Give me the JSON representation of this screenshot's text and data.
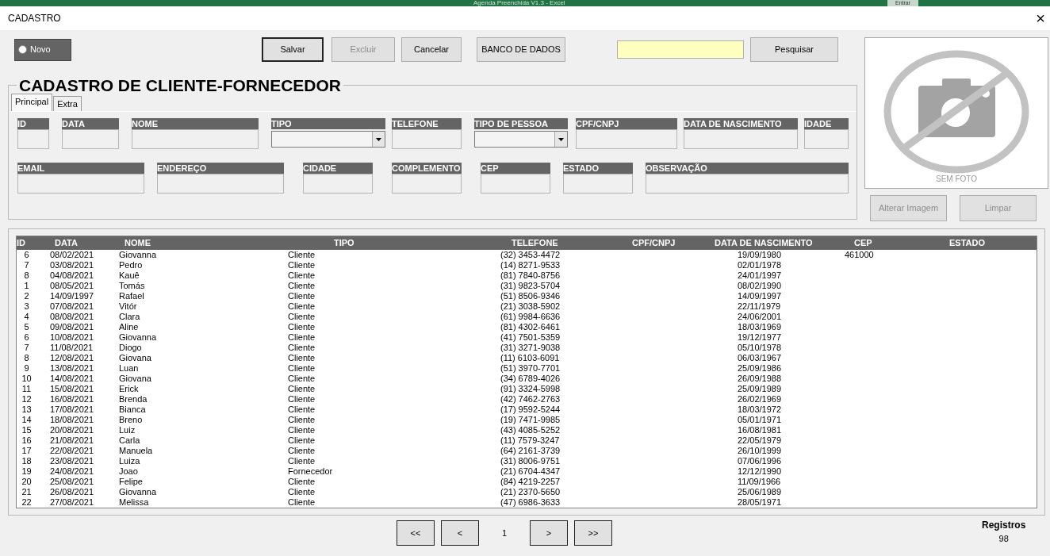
{
  "excel_bar": {
    "title": "Agenda Preenchida V1.3  -  Excel",
    "signin": "Entrar"
  },
  "window": {
    "title": "CADASTRO",
    "close": "×"
  },
  "toolbar": {
    "new_option": {
      "label": "Novo",
      "checked": false
    },
    "buttons": [
      {
        "label": "Salvar",
        "disabled": false,
        "default": true
      },
      {
        "label": "Excluir",
        "disabled": true,
        "default": false
      },
      {
        "label": "Cancelar",
        "disabled": false,
        "default": false
      },
      {
        "label": "BANCO DE DADOS",
        "disabled": false,
        "default": false
      }
    ],
    "search_button": "Pesquisar"
  },
  "form": {
    "title": "CADASTRO DE CLIENTE-FORNECEDOR",
    "tabs": [
      {
        "label": "Principal",
        "selected": true
      },
      {
        "label": "Extra",
        "selected": false
      }
    ],
    "field_rows": [
      {
        "fields": [
          {
            "label": "ID",
            "kind": "text"
          },
          {
            "label": "DATA",
            "kind": "text"
          },
          {
            "label": "NOME",
            "kind": "text"
          },
          {
            "label": "TIPO",
            "kind": "combo"
          },
          {
            "label": "TELEFONE",
            "kind": "text"
          },
          {
            "label": "TIPO DE PESSOA",
            "kind": "combo"
          },
          {
            "label": "CPF/CNPJ",
            "kind": "text"
          },
          {
            "label": "DATA DE NASCIMENTO",
            "kind": "text"
          },
          {
            "label": "IDADE",
            "kind": "text"
          }
        ]
      },
      {
        "fields": [
          {
            "label": "EMAIL",
            "kind": "text"
          },
          {
            "label": "ENDEREÇO",
            "kind": "text"
          },
          {
            "label": "CIDADE",
            "kind": "text"
          },
          {
            "label": "COMPLEMENTO",
            "kind": "text"
          },
          {
            "label": "CEP",
            "kind": "text"
          },
          {
            "label": "ESTADO",
            "kind": "text"
          },
          {
            "label": "OBSERVAÇÃO",
            "kind": "text"
          }
        ]
      }
    ]
  },
  "photo": {
    "caption": "SEM FOTO",
    "buttons": [
      {
        "label": "Alterar Imagem",
        "disabled": true
      },
      {
        "label": "Limpar",
        "disabled": true
      }
    ]
  },
  "table": {
    "columns": [
      "ID",
      "DATA",
      "NOME",
      "TIPO",
      "TELEFONE",
      "CPF/CNPJ",
      "DATA DE NASCIMENTO",
      "CEP",
      "ESTADO"
    ],
    "rows": [
      {
        "id": "6",
        "data": "08/02/2021",
        "nome": "Giovanna",
        "tipo": "Cliente",
        "telefone": "(32) 3453-4472",
        "nascimento": "19/09/1980",
        "cep": "461000"
      },
      {
        "id": "7",
        "data": "03/08/2021",
        "nome": "Pedro",
        "tipo": "Cliente",
        "telefone": "(14) 8271-9533",
        "nascimento": "02/01/1978"
      },
      {
        "id": "8",
        "data": "04/08/2021",
        "nome": "Kauê",
        "tipo": "Cliente",
        "telefone": "(81) 7840-8756",
        "nascimento": "24/01/1997"
      },
      {
        "id": "1",
        "data": "08/05/2021",
        "nome": "Tomás",
        "tipo": "Cliente",
        "telefone": "(31) 9823-5704",
        "nascimento": "08/02/1990"
      },
      {
        "id": "2",
        "data": "14/09/1997",
        "nome": "Rafael",
        "tipo": "Cliente",
        "telefone": "(51) 8506-9346",
        "nascimento": "14/09/1997"
      },
      {
        "id": "3",
        "data": "07/08/2021",
        "nome": "Vitór",
        "tipo": "Cliente",
        "telefone": "(21) 3038-5902",
        "nascimento": "22/11/1979"
      },
      {
        "id": "4",
        "data": "08/08/2021",
        "nome": "Clara",
        "tipo": "Cliente",
        "telefone": "(61) 9984-6636",
        "nascimento": "24/06/2001"
      },
      {
        "id": "5",
        "data": "09/08/2021",
        "nome": "Aline",
        "tipo": "Cliente",
        "telefone": "(81) 4302-6461",
        "nascimento": "18/03/1969"
      },
      {
        "id": "6",
        "data": "10/08/2021",
        "nome": "Giovanna",
        "tipo": "Cliente",
        "telefone": "(41) 7501-5359",
        "nascimento": "19/12/1977"
      },
      {
        "id": "7",
        "data": "11/08/2021",
        "nome": "Diogo",
        "tipo": "Cliente",
        "telefone": "(31) 3271-9038",
        "nascimento": "05/10/1978"
      },
      {
        "id": "8",
        "data": "12/08/2021",
        "nome": "Giovana",
        "tipo": "Cliente",
        "telefone": "(11) 6103-6091",
        "nascimento": "06/03/1967"
      },
      {
        "id": "9",
        "data": "13/08/2021",
        "nome": "Luan",
        "tipo": "Cliente",
        "telefone": "(51) 3970-7701",
        "nascimento": "25/09/1986"
      },
      {
        "id": "10",
        "data": "14/08/2021",
        "nome": "Giovana",
        "tipo": "Cliente",
        "telefone": "(34) 6789-4026",
        "nascimento": "26/09/1988"
      },
      {
        "id": "11",
        "data": "15/08/2021",
        "nome": "Erick",
        "tipo": "Cliente",
        "telefone": "(91) 3324-5998",
        "nascimento": "25/09/1989"
      },
      {
        "id": "12",
        "data": "16/08/2021",
        "nome": "Brenda",
        "tipo": "Cliente",
        "telefone": "(42) 7462-2763",
        "nascimento": "26/02/1969"
      },
      {
        "id": "13",
        "data": "17/08/2021",
        "nome": "Bianca",
        "tipo": "Cliente",
        "telefone": "(17) 9592-5244",
        "nascimento": "18/03/1972"
      },
      {
        "id": "14",
        "data": "18/08/2021",
        "nome": "Breno",
        "tipo": "Cliente",
        "telefone": "(19) 7471-9985",
        "nascimento": "05/01/1971"
      },
      {
        "id": "15",
        "data": "20/08/2021",
        "nome": "Luiz",
        "tipo": "Cliente",
        "telefone": "(43) 4085-5252",
        "nascimento": "16/08/1981"
      },
      {
        "id": "16",
        "data": "21/08/2021",
        "nome": "Carla",
        "tipo": "Cliente",
        "telefone": "(11) 7579-3247",
        "nascimento": "22/05/1979"
      },
      {
        "id": "17",
        "data": "22/08/2021",
        "nome": "Manuela",
        "tipo": "Cliente",
        "telefone": "(64) 2161-3739",
        "nascimento": "26/10/1999"
      },
      {
        "id": "18",
        "data": "23/08/2021",
        "nome": "Luiza",
        "tipo": "Cliente",
        "telefone": "(31) 8006-9751",
        "nascimento": "07/06/1996"
      },
      {
        "id": "19",
        "data": "24/08/2021",
        "nome": "Joao",
        "tipo": "Fornecedor",
        "telefone": "(21) 6704-4347",
        "nascimento": "12/12/1990"
      },
      {
        "id": "20",
        "data": "25/08/2021",
        "nome": "Felipe",
        "tipo": "Cliente",
        "telefone": "(84) 4219-2257",
        "nascimento": "11/09/1966"
      },
      {
        "id": "21",
        "data": "26/08/2021",
        "nome": "Giovanna",
        "tipo": "Cliente",
        "telefone": "(21) 2370-5650",
        "nascimento": "25/06/1989"
      },
      {
        "id": "22",
        "data": "27/08/2021",
        "nome": "Melissa",
        "tipo": "Cliente",
        "telefone": "(47) 6986-3633",
        "nascimento": "28/05/1971"
      }
    ]
  },
  "pager": {
    "first": "<<",
    "prev": "<",
    "page": "1",
    "next": ">",
    "last": ">>"
  },
  "records": {
    "label": "Registros",
    "count": "98"
  }
}
